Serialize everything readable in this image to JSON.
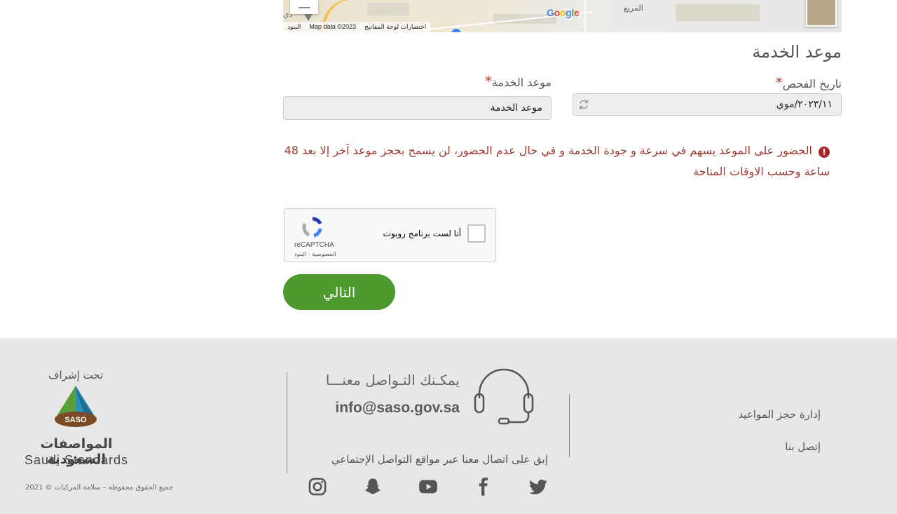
{
  "map": {
    "zoom_out_label": "—",
    "place_label": "المربع",
    "edge_label": "ذي",
    "google_letters": [
      "G",
      "o",
      "o",
      "g",
      "l",
      "e"
    ],
    "google_colors": [
      "#4285f4",
      "#ea4335",
      "#fbbc05",
      "#4285f4",
      "#34a853",
      "#ea4335"
    ],
    "attribution": {
      "terms": "البنود",
      "map_data": "Map data ©2023",
      "shortcuts": "اختصارات لوحة المفاتيح"
    }
  },
  "form": {
    "section_title": "موعد الخدمة",
    "exam_date_label": "تاريخ الفحص",
    "exam_date_value": "٢٠٢٣/١١/موي",
    "service_time_label": "موعد الخدمة",
    "service_time_value": "موعد الخدمة",
    "required_mark": "*",
    "warning_text": "الحضور على الموعد يسهم في سرعة و جودة الخدمة و في حال عدم الحضور، لن يسمح بحجز موعد آخر إلا بعد 48 ساعة وحسب الاوقات المتاحة",
    "warning_icon": "!",
    "next_button": "التالي"
  },
  "captcha": {
    "label": "أنا لست برنامج روبوت",
    "brand": "reCAPTCHA",
    "links": "الخصوصية - البنود"
  },
  "footer": {
    "links": [
      "إدارة حجز المواعيد",
      "إتصل بنا"
    ],
    "contact_title": "يمكـنك التـواصل معنـــا",
    "contact_email": "info@saso.gov.sa",
    "social_text": "إبق على اتصال معنا عبر مواقع التواصل الإجتماعي",
    "supervision": "تحت إشراف",
    "saso_short": "SASO",
    "saso_name_ar": "المواصفات السعودية",
    "saso_name_en": "Saudi Standards",
    "copyright": "جميع الحقوق محفوظة – سلامة المركبات © 2021"
  },
  "colors": {
    "accent_green": "#4d9a2f",
    "warning_red": "#9b3b34",
    "footer_bg": "#e7e7e7"
  }
}
